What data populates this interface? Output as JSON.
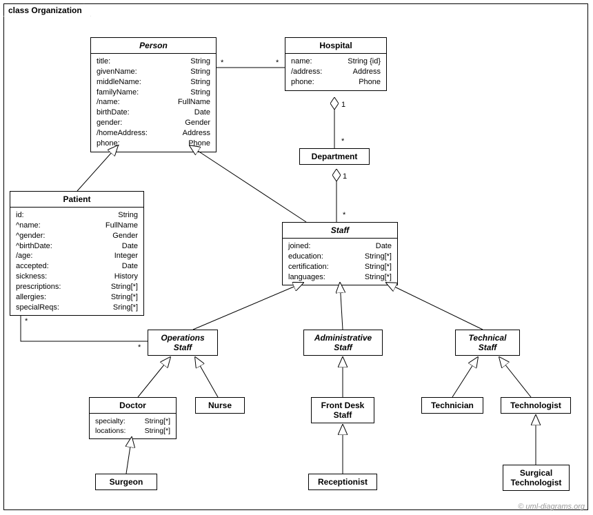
{
  "frame": {
    "title": "class Organization"
  },
  "classes": {
    "person": {
      "name": "Person",
      "attrs": [
        [
          "title:",
          "String"
        ],
        [
          "givenName:",
          "String"
        ],
        [
          "middleName:",
          "String"
        ],
        [
          "familyName:",
          "String"
        ],
        [
          "/name:",
          "FullName"
        ],
        [
          "birthDate:",
          "Date"
        ],
        [
          "gender:",
          "Gender"
        ],
        [
          "/homeAddress:",
          "Address"
        ],
        [
          "phone:",
          "Phone"
        ]
      ]
    },
    "hospital": {
      "name": "Hospital",
      "attrs": [
        [
          "name:",
          "String {id}"
        ],
        [
          "/address:",
          "Address"
        ],
        [
          "phone:",
          "Phone"
        ]
      ]
    },
    "department": {
      "name": "Department"
    },
    "patient": {
      "name": "Patient",
      "attrs": [
        [
          "id:",
          "String"
        ],
        [
          "^name:",
          "FullName"
        ],
        [
          "^gender:",
          "Gender"
        ],
        [
          "^birthDate:",
          "Date"
        ],
        [
          "/age:",
          "Integer"
        ],
        [
          "accepted:",
          "Date"
        ],
        [
          "sickness:",
          "History"
        ],
        [
          "prescriptions:",
          "String[*]"
        ],
        [
          "allergies:",
          "String[*]"
        ],
        [
          "specialReqs:",
          "Sring[*]"
        ]
      ]
    },
    "staff": {
      "name": "Staff",
      "attrs": [
        [
          "joined:",
          "Date"
        ],
        [
          "education:",
          "String[*]"
        ],
        [
          "certification:",
          "String[*]"
        ],
        [
          "languages:",
          "String[*]"
        ]
      ]
    },
    "opsStaff": {
      "name_l1": "Operations",
      "name_l2": "Staff"
    },
    "adminStaff": {
      "name_l1": "Administrative",
      "name_l2": "Staff"
    },
    "techStaff": {
      "name_l1": "Technical",
      "name_l2": "Staff"
    },
    "doctor": {
      "name": "Doctor",
      "attrs": [
        [
          "specialty:",
          "String[*]"
        ],
        [
          "locations:",
          "String[*]"
        ]
      ]
    },
    "nurse": {
      "name": "Nurse"
    },
    "frontDesk": {
      "name_l1": "Front Desk",
      "name_l2": "Staff"
    },
    "technician": {
      "name": "Technician"
    },
    "technologist": {
      "name": "Technologist"
    },
    "surgeon": {
      "name": "Surgeon"
    },
    "receptionist": {
      "name": "Receptionist"
    },
    "surgTech": {
      "name_l1": "Surgical",
      "name_l2": "Technologist"
    }
  },
  "mults": {
    "personHosp_person": "*",
    "personHosp_hosp": "*",
    "hospDept_hosp": "1",
    "hospDept_dept": "*",
    "deptStaff_dept": "1",
    "deptStaff_staff": "*",
    "opsPatient_ops": "*",
    "opsPatient_patient": "*"
  },
  "watermark": "© uml-diagrams.org"
}
